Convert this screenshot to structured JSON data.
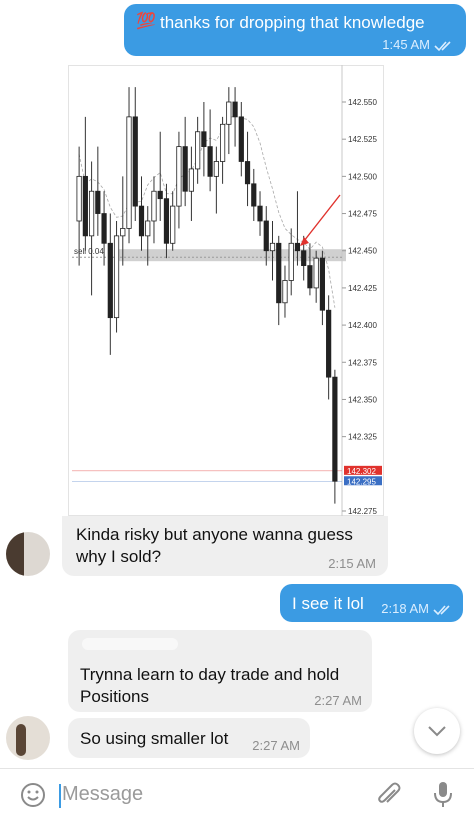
{
  "messages": [
    {
      "text": "thanks for dropping that knowledge",
      "emoji": "💯",
      "time": "1:45 AM"
    },
    {
      "text": "Kinda risky but anyone wanna guess why I sold?",
      "time": "2:15 AM"
    },
    {
      "text": "I see it lol",
      "time": "2:18 AM"
    },
    {
      "text": "Trynna learn to day trade and hold Positions",
      "time": "2:27 AM"
    },
    {
      "text": "So using smaller lot",
      "time": "2:27 AM"
    }
  ],
  "input": {
    "placeholder": "Message"
  },
  "icons": {
    "emoji": "emoji-icon",
    "attach": "paperclip-icon",
    "mic": "microphone-icon",
    "scroll": "chevron-down-icon"
  },
  "colors": {
    "outgoing": "#3b9be3",
    "incoming": "#efefef",
    "sell_band": "#c8c8c8",
    "price_label": "#e0322d",
    "bid_label": "#3b6fc4"
  },
  "chart_data": {
    "type": "candlestick",
    "yticks": [
      "142.550",
      "142.525",
      "142.500",
      "142.475",
      "142.450",
      "142.425",
      "142.400",
      "142.375",
      "142.350",
      "142.325",
      "142.275"
    ],
    "ylim": [
      142.275,
      142.56
    ],
    "sell_label": "sell 0.04",
    "sell_level": 142.447,
    "price_labels": [
      "142.302",
      "142.295"
    ],
    "price_levels": [
      142.302,
      142.295
    ],
    "candles": [
      {
        "o": 142.47,
        "h": 142.52,
        "l": 142.44,
        "c": 142.5
      },
      {
        "o": 142.5,
        "h": 142.54,
        "l": 142.45,
        "c": 142.46
      },
      {
        "o": 142.46,
        "h": 142.51,
        "l": 142.42,
        "c": 142.49
      },
      {
        "o": 142.49,
        "h": 142.52,
        "l": 142.46,
        "c": 142.475
      },
      {
        "o": 142.475,
        "h": 142.49,
        "l": 142.44,
        "c": 142.455
      },
      {
        "o": 142.455,
        "h": 142.475,
        "l": 142.38,
        "c": 142.405
      },
      {
        "o": 142.405,
        "h": 142.47,
        "l": 142.395,
        "c": 142.46
      },
      {
        "o": 142.46,
        "h": 142.5,
        "l": 142.44,
        "c": 142.465
      },
      {
        "o": 142.465,
        "h": 142.56,
        "l": 142.455,
        "c": 142.54
      },
      {
        "o": 142.54,
        "h": 142.56,
        "l": 142.47,
        "c": 142.48
      },
      {
        "o": 142.48,
        "h": 142.5,
        "l": 142.45,
        "c": 142.46
      },
      {
        "o": 142.46,
        "h": 142.48,
        "l": 142.44,
        "c": 142.47
      },
      {
        "o": 142.47,
        "h": 142.5,
        "l": 142.455,
        "c": 142.49
      },
      {
        "o": 142.49,
        "h": 142.53,
        "l": 142.47,
        "c": 142.485
      },
      {
        "o": 142.485,
        "h": 142.495,
        "l": 142.445,
        "c": 142.455
      },
      {
        "o": 142.455,
        "h": 142.49,
        "l": 142.45,
        "c": 142.48
      },
      {
        "o": 142.48,
        "h": 142.53,
        "l": 142.465,
        "c": 142.52
      },
      {
        "o": 142.52,
        "h": 142.54,
        "l": 142.48,
        "c": 142.49
      },
      {
        "o": 142.49,
        "h": 142.52,
        "l": 142.47,
        "c": 142.505
      },
      {
        "o": 142.505,
        "h": 142.54,
        "l": 142.495,
        "c": 142.53
      },
      {
        "o": 142.53,
        "h": 142.55,
        "l": 142.5,
        "c": 142.52
      },
      {
        "o": 142.52,
        "h": 142.545,
        "l": 142.49,
        "c": 142.5
      },
      {
        "o": 142.5,
        "h": 142.52,
        "l": 142.475,
        "c": 142.51
      },
      {
        "o": 142.51,
        "h": 142.54,
        "l": 142.495,
        "c": 142.535
      },
      {
        "o": 142.535,
        "h": 142.56,
        "l": 142.515,
        "c": 142.55
      },
      {
        "o": 142.55,
        "h": 142.56,
        "l": 142.52,
        "c": 142.54
      },
      {
        "o": 142.54,
        "h": 142.55,
        "l": 142.5,
        "c": 142.51
      },
      {
        "o": 142.51,
        "h": 142.53,
        "l": 142.48,
        "c": 142.495
      },
      {
        "o": 142.495,
        "h": 142.505,
        "l": 142.47,
        "c": 142.48
      },
      {
        "o": 142.48,
        "h": 142.49,
        "l": 142.46,
        "c": 142.47
      },
      {
        "o": 142.47,
        "h": 142.48,
        "l": 142.44,
        "c": 142.45
      },
      {
        "o": 142.45,
        "h": 142.47,
        "l": 142.43,
        "c": 142.455
      },
      {
        "o": 142.455,
        "h": 142.46,
        "l": 142.4,
        "c": 142.415
      },
      {
        "o": 142.415,
        "h": 142.44,
        "l": 142.405,
        "c": 142.43
      },
      {
        "o": 142.43,
        "h": 142.465,
        "l": 142.42,
        "c": 142.455
      },
      {
        "o": 142.455,
        "h": 142.49,
        "l": 142.44,
        "c": 142.45
      },
      {
        "o": 142.45,
        "h": 142.46,
        "l": 142.43,
        "c": 142.44
      },
      {
        "o": 142.44,
        "h": 142.455,
        "l": 142.42,
        "c": 142.425
      },
      {
        "o": 142.425,
        "h": 142.45,
        "l": 142.415,
        "c": 142.445
      },
      {
        "o": 142.445,
        "h": 142.45,
        "l": 142.4,
        "c": 142.41
      },
      {
        "o": 142.41,
        "h": 142.42,
        "l": 142.35,
        "c": 142.365
      },
      {
        "o": 142.365,
        "h": 142.37,
        "l": 142.28,
        "c": 142.295
      }
    ]
  }
}
